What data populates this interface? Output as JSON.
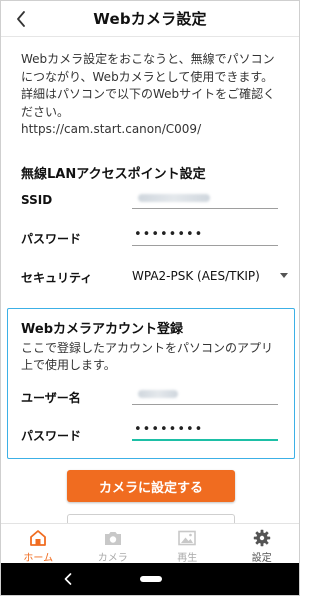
{
  "header": {
    "title": "Webカメラ設定",
    "back_icon": "chevron-left-icon"
  },
  "intro": {
    "line1": "Webカメラ設定をおこなうと、無線でパソコンにつながり、Webカメラとして使用できます。",
    "line2": "詳細はパソコンで以下のWebサイトをご確認ください。",
    "url": "https://cam.start.canon/C009/"
  },
  "wlan": {
    "heading": "無線LANアクセスポイント設定",
    "ssid_label": "SSID",
    "password_label": "パスワード",
    "password_value": "••••••••",
    "security_label": "セキュリティ",
    "security_value": "WPA2-PSK (AES/TKIP)"
  },
  "account": {
    "heading": "Webカメラアカウント登録",
    "description": "ここで登録したアカウントをパソコンのアプリ上で使用します。",
    "username_label": "ユーザー名",
    "password_label": "パスワード",
    "password_value": "••••••••"
  },
  "actions": {
    "primary_label": "カメラに設定する"
  },
  "tabs": [
    {
      "label": "ホーム",
      "icon": "home-icon",
      "active": true
    },
    {
      "label": "カメラ",
      "icon": "camera-icon",
      "active": false
    },
    {
      "label": "再生",
      "icon": "image-icon",
      "active": false
    },
    {
      "label": "設定",
      "icon": "gear-icon",
      "active": false
    }
  ],
  "colors": {
    "accent": "#f06c20",
    "frame": "#3cb0e6",
    "focus": "#1dbfa6"
  }
}
